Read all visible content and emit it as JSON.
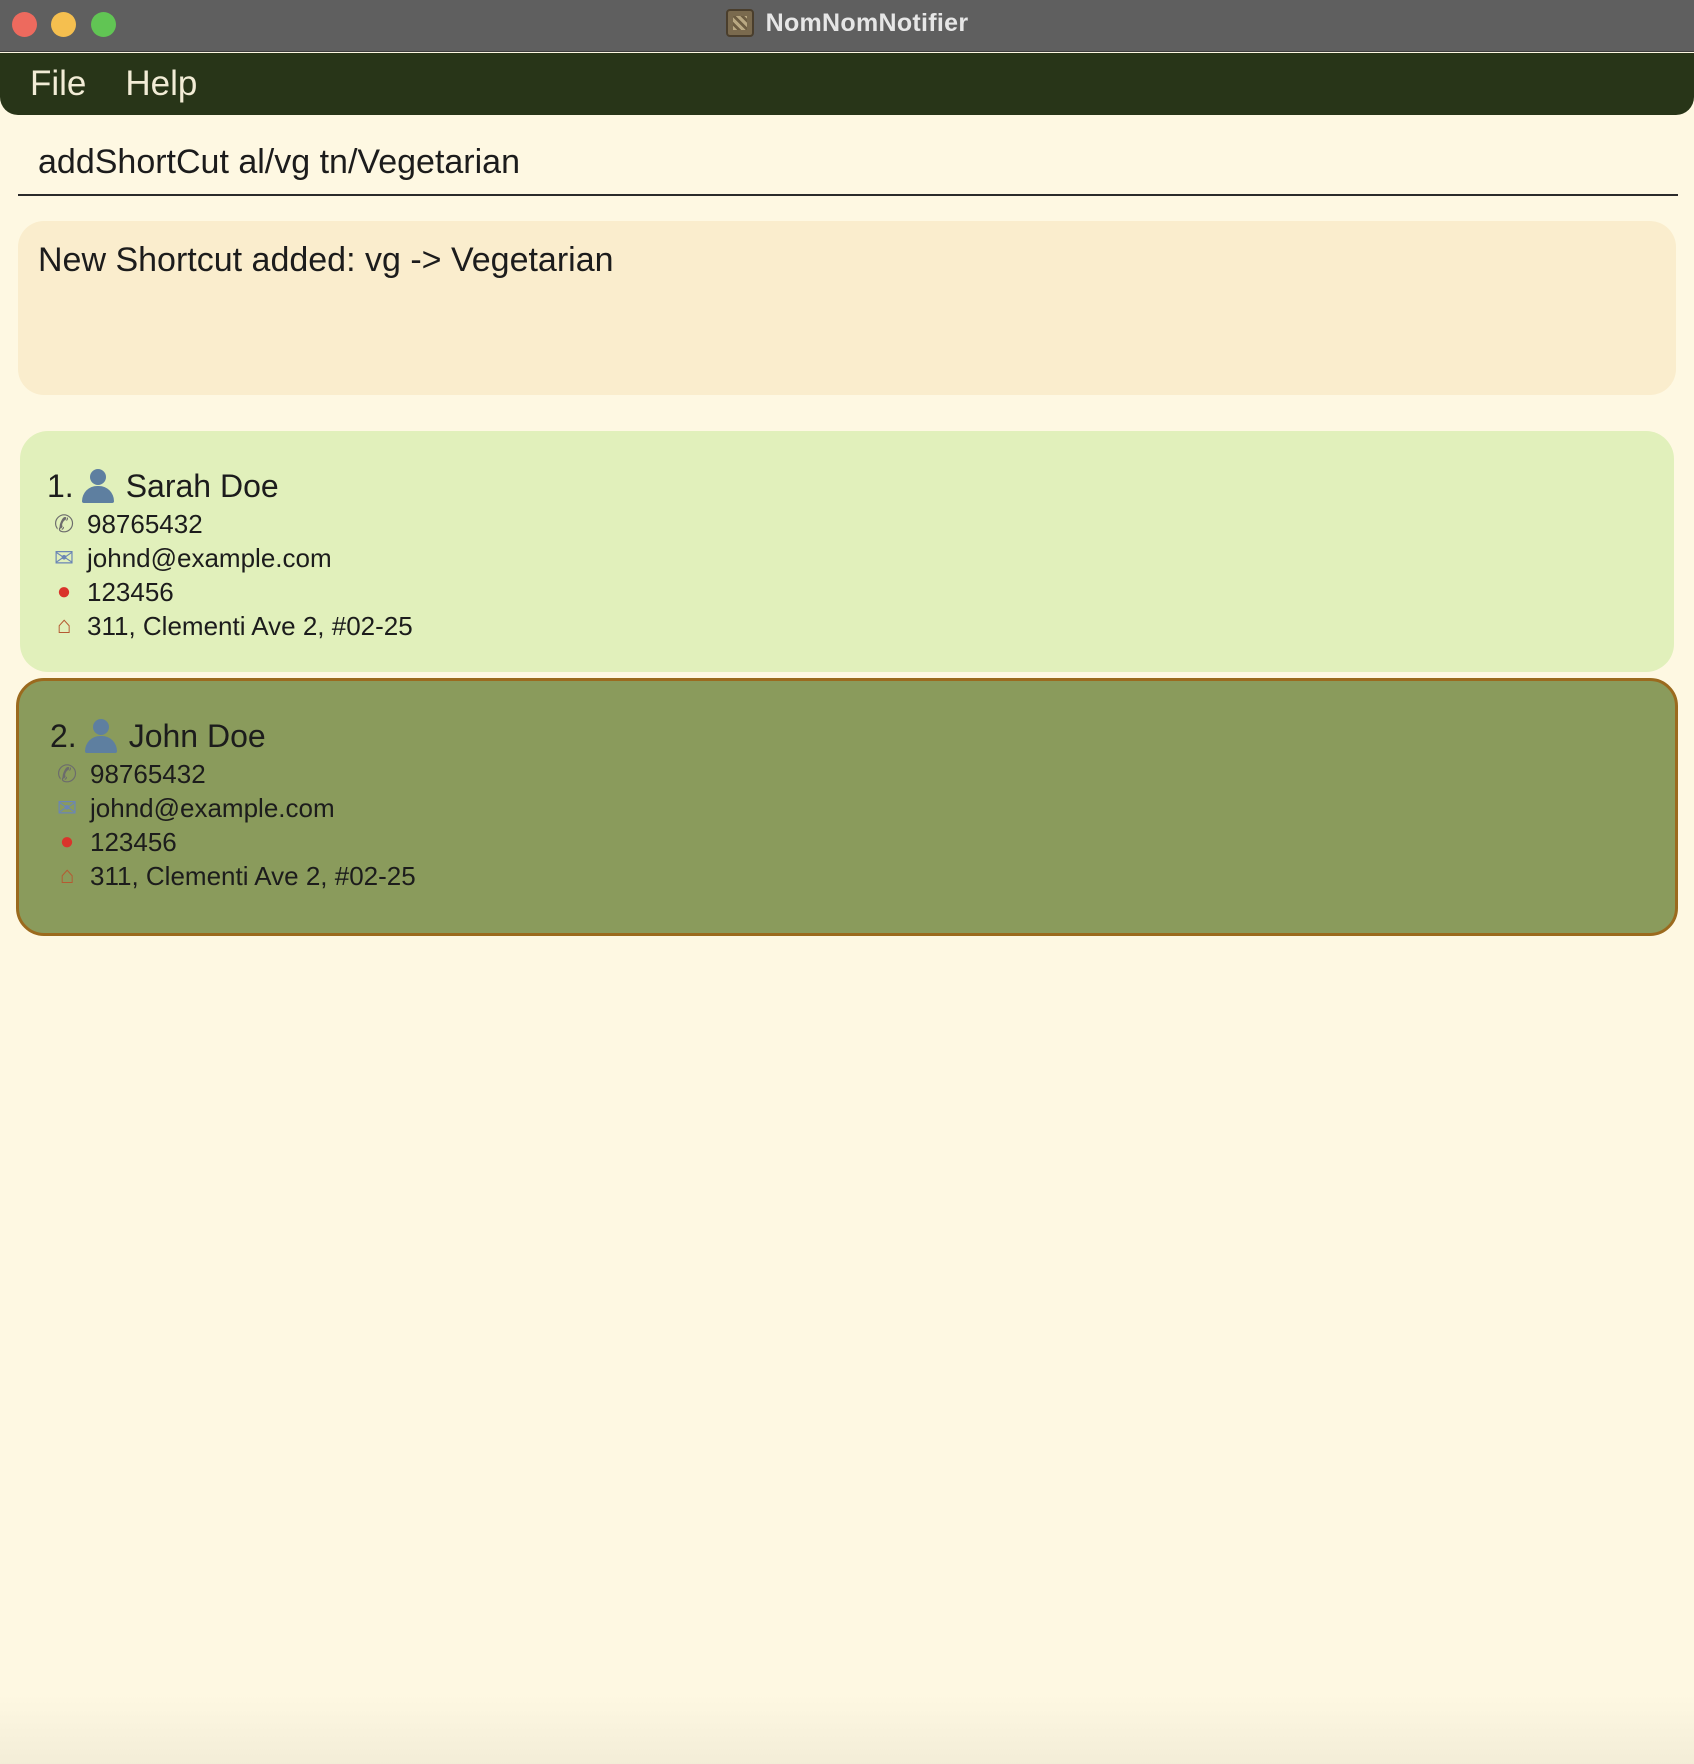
{
  "window": {
    "title": "NomNomNotifier"
  },
  "menu": {
    "items": [
      {
        "label": "File"
      },
      {
        "label": "Help"
      }
    ]
  },
  "command": {
    "value": "addShortCut al/vg tn/Vegetarian"
  },
  "result": {
    "message": "New Shortcut added: vg -> Vegetarian"
  },
  "persons": [
    {
      "index": "1.",
      "name": "Sarah Doe",
      "phone": "98765432",
      "email": "johnd@example.com",
      "postal": "123456",
      "address": "311, Clementi Ave 2, #02-25",
      "selected": false
    },
    {
      "index": "2.",
      "name": "John Doe",
      "phone": "98765432",
      "email": "johnd@example.com",
      "postal": "123456",
      "address": "311, Clementi Ave 2, #02-25",
      "selected": true
    }
  ],
  "icons": {
    "person": "person-icon",
    "phone": "phone-icon",
    "email": "email-icon",
    "postal": "pin-icon",
    "address": "house-icon"
  },
  "colors": {
    "background": "#fef8e2",
    "menubar": "#283518",
    "result_box": "#faedcd",
    "card_default": "#e1f0bb",
    "card_selected": "#8a9b5c",
    "card_selected_border": "#9b6a1e"
  }
}
